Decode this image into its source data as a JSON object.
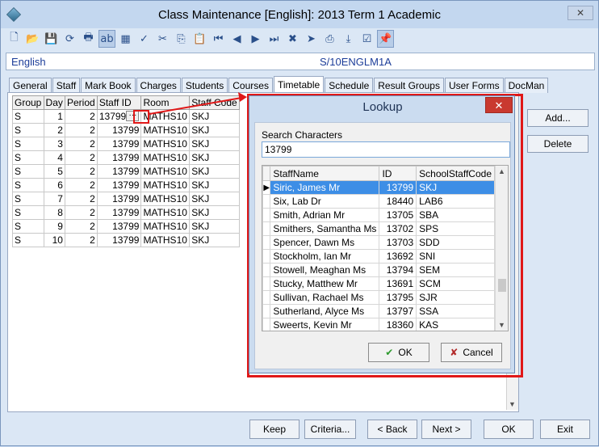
{
  "window": {
    "title": "Class Maintenance  [English]: 2013 Term 1 Academic",
    "close_glyph": "✕"
  },
  "toolbar": {
    "buttons": [
      {
        "name": "new-icon",
        "glyph": "🗋"
      },
      {
        "name": "open-icon",
        "glyph": "📂"
      },
      {
        "name": "save-icon",
        "glyph": "💾"
      },
      {
        "name": "refresh-icon",
        "glyph": "⟳"
      },
      {
        "name": "print-icon",
        "glyph": "🖶"
      },
      {
        "name": "field-icon",
        "glyph": "ab"
      },
      {
        "name": "calculator-icon",
        "glyph": "▦"
      },
      {
        "name": "spellcheck-icon",
        "glyph": "✓"
      },
      {
        "name": "cut-icon",
        "glyph": "✂"
      },
      {
        "name": "copy-icon",
        "glyph": "⎘"
      },
      {
        "name": "paste-icon",
        "glyph": "📋"
      },
      {
        "name": "first-record-icon",
        "glyph": "⏮"
      },
      {
        "name": "previous-record-icon",
        "glyph": "◀"
      },
      {
        "name": "next-record-icon",
        "glyph": "▶"
      },
      {
        "name": "last-record-icon",
        "glyph": "⏭"
      },
      {
        "name": "delete-icon",
        "glyph": "✖"
      },
      {
        "name": "filter-icon",
        "glyph": "➤"
      },
      {
        "name": "stamp-icon",
        "glyph": "⎙"
      },
      {
        "name": "download-icon",
        "glyph": "⤓"
      },
      {
        "name": "checklist-icon",
        "glyph": "☑"
      },
      {
        "name": "pin-icon",
        "glyph": "📌"
      }
    ]
  },
  "infobar": {
    "subject": "English",
    "class_code": "S/10ENGLM1A"
  },
  "tabs": [
    "General",
    "Staff",
    "Mark Book",
    "Charges",
    "Students",
    "Courses",
    "Timetable",
    "Schedule",
    "Result Groups",
    "User Forms",
    "DocMan"
  ],
  "active_tab": "Timetable",
  "timetable": {
    "headers": [
      "Group",
      "Day",
      "Period",
      "Staff ID",
      "Room",
      "Staff Code"
    ],
    "rows": [
      [
        "S",
        "1",
        "2",
        "13799",
        "MATHS10",
        "SKJ"
      ],
      [
        "S",
        "2",
        "2",
        "13799",
        "MATHS10",
        "SKJ"
      ],
      [
        "S",
        "3",
        "2",
        "13799",
        "MATHS10",
        "SKJ"
      ],
      [
        "S",
        "4",
        "2",
        "13799",
        "MATHS10",
        "SKJ"
      ],
      [
        "S",
        "5",
        "2",
        "13799",
        "MATHS10",
        "SKJ"
      ],
      [
        "S",
        "6",
        "2",
        "13799",
        "MATHS10",
        "SKJ"
      ],
      [
        "S",
        "7",
        "2",
        "13799",
        "MATHS10",
        "SKJ"
      ],
      [
        "S",
        "8",
        "2",
        "13799",
        "MATHS10",
        "SKJ"
      ],
      [
        "S",
        "9",
        "2",
        "13799",
        "MATHS10",
        "SKJ"
      ],
      [
        "S",
        "10",
        "2",
        "13799",
        "MATHS10",
        "SKJ"
      ]
    ],
    "ellipsis": "···"
  },
  "side_buttons": {
    "add": "Add...",
    "delete": "Delete"
  },
  "bottom_buttons": {
    "keep": "Keep",
    "criteria": "Criteria...",
    "back": "< Back",
    "next": "Next >",
    "ok": "OK",
    "exit": "Exit"
  },
  "lookup": {
    "title": "Lookup",
    "close_glyph": "✕",
    "search_label": "Search Characters",
    "search_value": "13799",
    "headers": [
      "StaffName",
      "ID",
      "SchoolStaffCode"
    ],
    "rows": [
      {
        "name": "Siric, James Mr",
        "id": "13799",
        "code": "SKJ",
        "selected": true
      },
      {
        "name": "Six, Lab Dr",
        "id": "18440",
        "code": "LAB6"
      },
      {
        "name": "Smith, Adrian Mr",
        "id": "13705",
        "code": "SBA"
      },
      {
        "name": "Smithers, Samantha Ms",
        "id": "13702",
        "code": "SPS"
      },
      {
        "name": "Spencer, Dawn Ms",
        "id": "13703",
        "code": "SDD"
      },
      {
        "name": "Stockholm, Ian Mr",
        "id": "13692",
        "code": "SNI"
      },
      {
        "name": "Stowell, Meaghan Ms",
        "id": "13794",
        "code": "SEM"
      },
      {
        "name": "Stucky, Matthew Mr",
        "id": "13691",
        "code": "SCM"
      },
      {
        "name": "Sullivan, Rachael Ms",
        "id": "13795",
        "code": "SJR"
      },
      {
        "name": "Sutherland, Alyce Ms",
        "id": "13797",
        "code": "SSA"
      },
      {
        "name": "Sweerts, Kevin Mr",
        "id": "18360",
        "code": "KAS"
      }
    ],
    "ok_label": "OK",
    "cancel_label": "Cancel",
    "ok_glyph": "✔",
    "cancel_glyph": "✘"
  }
}
